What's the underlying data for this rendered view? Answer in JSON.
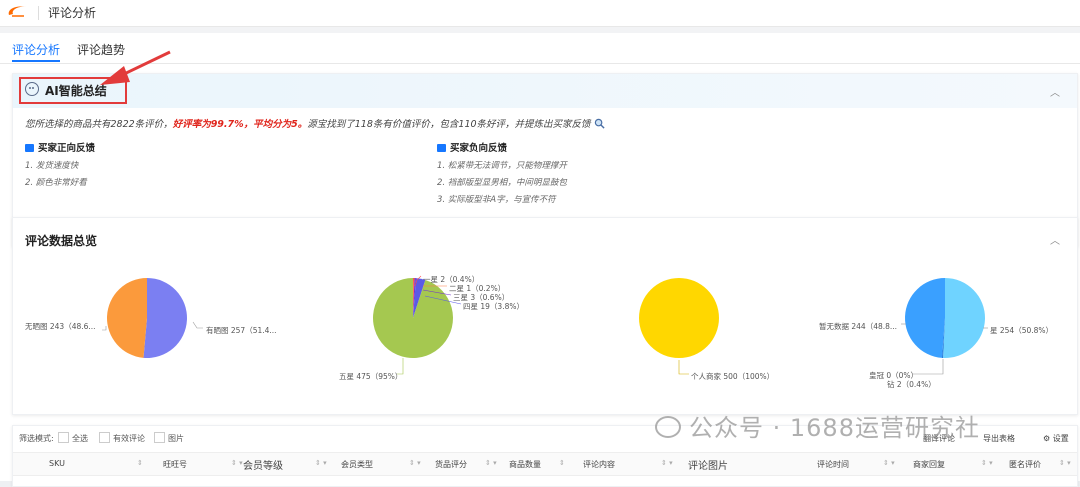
{
  "header": {
    "app_title": "评论分析"
  },
  "tabs": [
    {
      "label": "评论分析",
      "active": true
    },
    {
      "label": "评论趋势",
      "active": false
    }
  ],
  "ai_summary": {
    "title": "AI智能总结",
    "text_part1": "您所选择的商品共有2822条评价，",
    "text_highlight": "好评率为99.7%，平均分为5。",
    "text_part2": "源宝找到了118条有价值评价，包含110条好评，并提炼出买家反馈",
    "positive": {
      "title": "买家正向反馈",
      "items": [
        "1. 发货速度快",
        "2. 颜色非常好看"
      ]
    },
    "negative": {
      "title": "买家负向反馈",
      "items": [
        "1. 松紧带无法调节，只能物理撑开",
        "2. 裆部版型显男相，中间明显鼓包",
        "3. 实际版型非A字，与宣传不符"
      ]
    }
  },
  "stats": {
    "title": "评论数据总览",
    "pies": [
      {
        "slices": [
          {
            "label": "有晒图 257（51.4...",
            "value": 257,
            "color": "#7b7ff2"
          },
          {
            "label": "无晒图 243（48.6...",
            "value": 243,
            "color": "#fb9a3c"
          }
        ]
      },
      {
        "slices": [
          {
            "label": "一星 2（0.4%）",
            "value": 2,
            "color": "#ff4d4f"
          },
          {
            "label": "二星 1（0.2%）",
            "value": 1,
            "color": "#ff7a45"
          },
          {
            "label": "三星 3（0.6%）",
            "value": 3,
            "color": "#722ed1"
          },
          {
            "label": "四星 19（3.8%）",
            "value": 19,
            "color": "#5b5be6"
          },
          {
            "label": "五星 475（95%）",
            "value": 475,
            "color": "#a5c850"
          }
        ]
      },
      {
        "slices": [
          {
            "label": "个人商家 500（100%）",
            "value": 500,
            "color": "#ffd700"
          }
        ]
      },
      {
        "slices": [
          {
            "label": "星 254（50.8%）",
            "value": 254,
            "color": "#6fd3ff"
          },
          {
            "label": "钻 2（0.4%）",
            "value": 2,
            "color": "#1a6fd6"
          },
          {
            "label": "皇冠 0（0%）",
            "value": 0,
            "color": "#ffc53d"
          },
          {
            "label": "暂无数据 244（48.8...",
            "value": 244,
            "color": "#3aa0ff"
          }
        ]
      }
    ]
  },
  "table": {
    "filter_label": "筛选模式:",
    "filters": [
      "全选",
      "有效评论",
      "图片"
    ],
    "tools": [
      "翻译评论",
      "导出表格",
      "设置"
    ],
    "columns": [
      "SKU",
      "旺旺号",
      "会员等级",
      "会员类型",
      "货品评分",
      "商品数量",
      "评论内容",
      "评论图片",
      "评论时间",
      "商家回复",
      "匿名评价"
    ]
  },
  "watermark": "公众号 · 1688运营研究社"
}
